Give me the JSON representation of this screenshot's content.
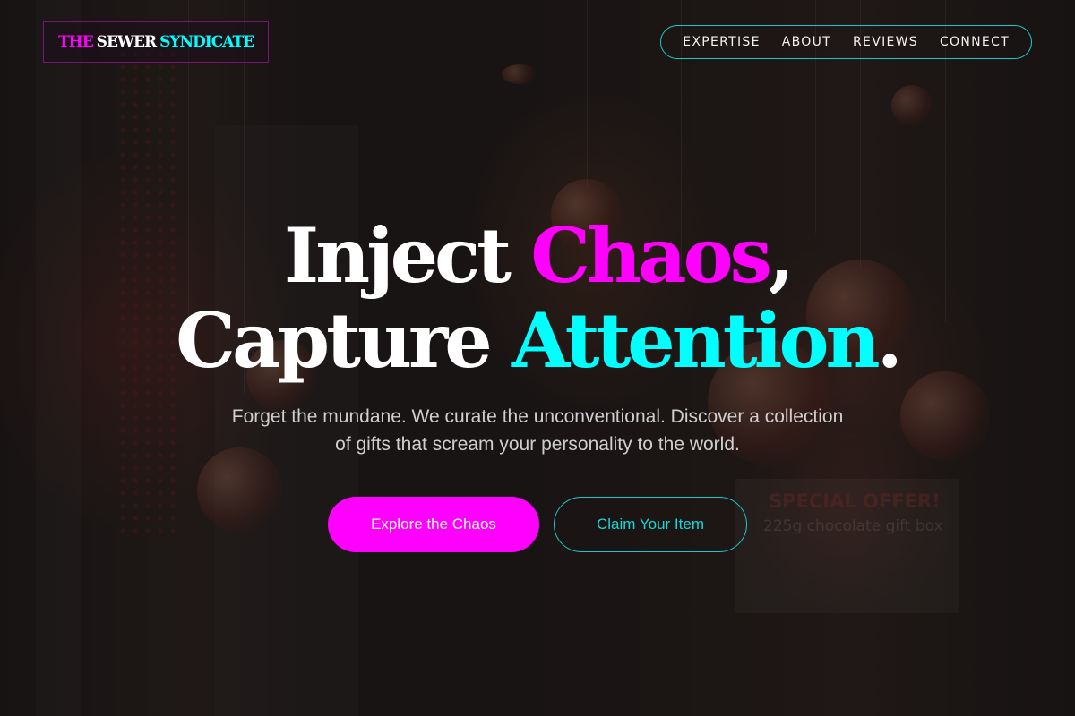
{
  "brand": {
    "word1": "THE",
    "word2": "SEWER",
    "word3": "SYNDICATE",
    "colors": {
      "pink": "#ff00ff",
      "white": "#ffffff",
      "cyan": "#00ffff"
    }
  },
  "nav": {
    "items": [
      {
        "label": "EXPERTISE"
      },
      {
        "label": "ABOUT"
      },
      {
        "label": "REVIEWS"
      },
      {
        "label": "CONNECT"
      }
    ],
    "border_color": "#19c9c9"
  },
  "hero": {
    "background_sign": {
      "title": "SPECIAL OFFER!",
      "subtitle": "225g chocolate gift box"
    },
    "headline": {
      "line1_a": "Inject",
      "line1_b": "Chaos",
      "line1_c": ",",
      "line2_a": "Capture",
      "line2_b": "Attention",
      "line2_c": "."
    },
    "subtitle": "Forget the mundane. We curate the unconventional. Discover a collection of gifts that scream your personality to the world.",
    "primary_cta": "Explore the Chaos",
    "secondary_cta": "Claim Your Item"
  }
}
